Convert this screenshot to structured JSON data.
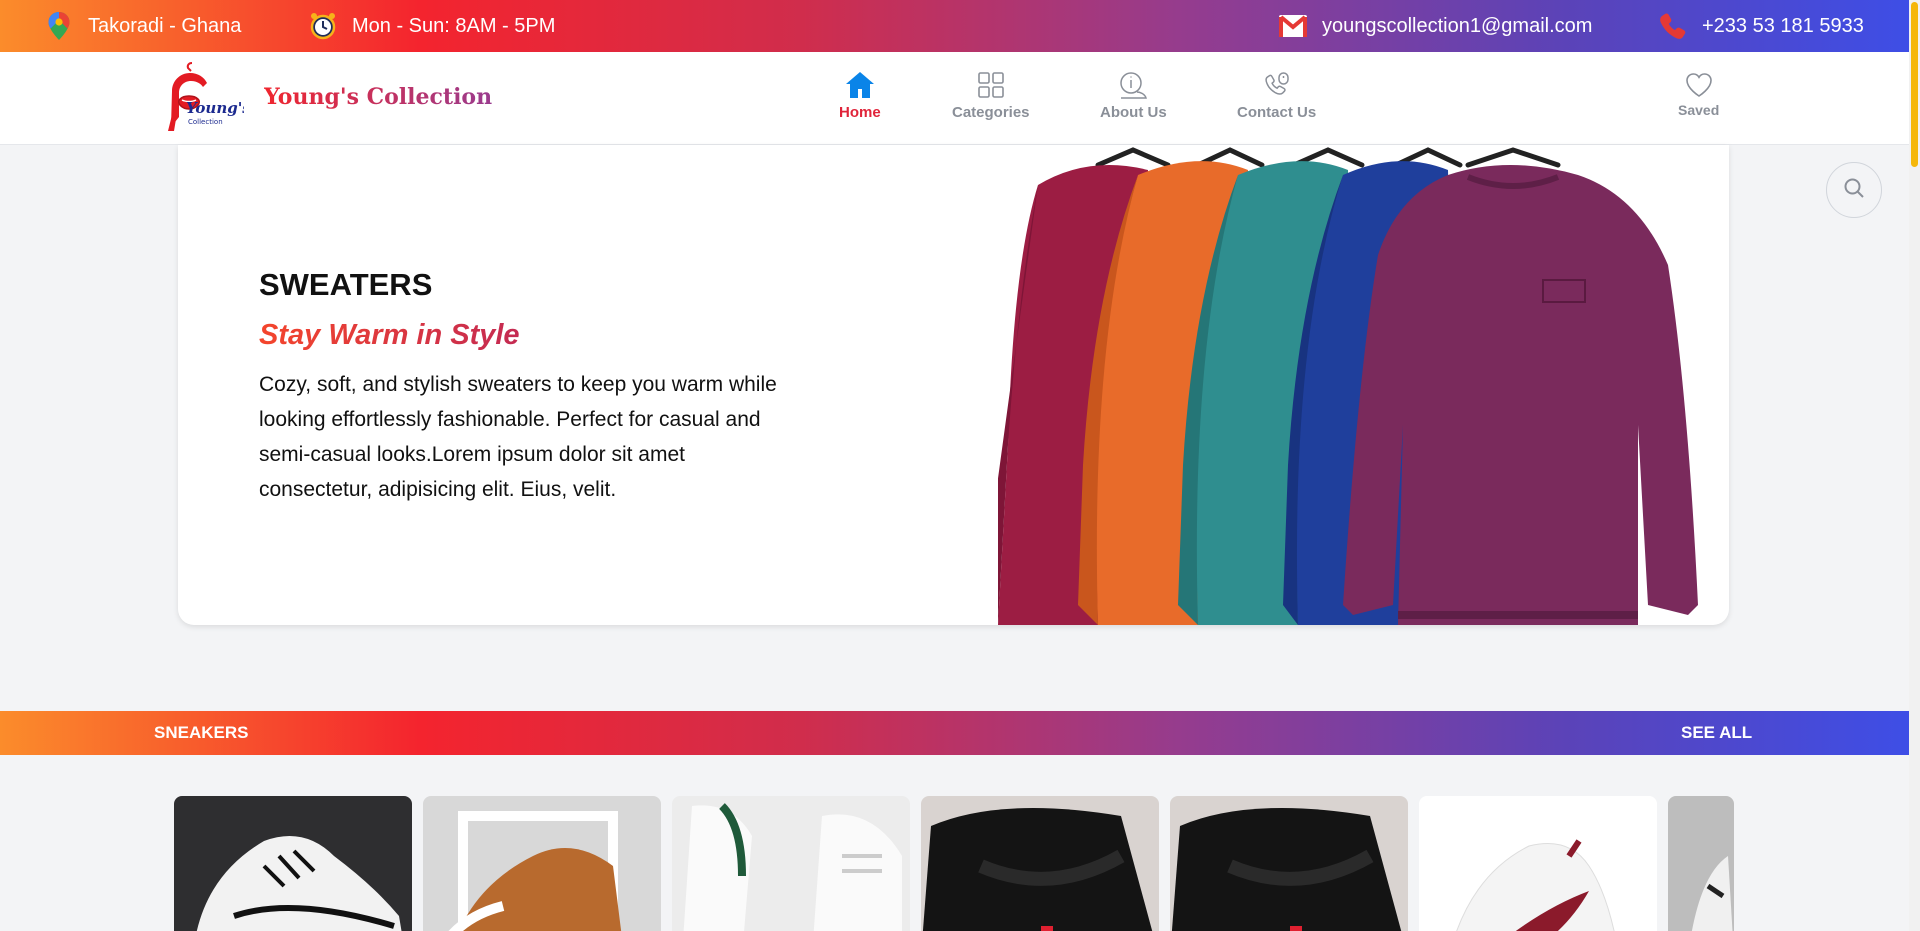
{
  "topbar": {
    "location": "Takoradi - Ghana",
    "hours": "Mon - Sun: 8AM - 5PM",
    "email": "youngscollection1@gmail.com",
    "phone": "+233 53 181 5933",
    "icons": [
      "map-pin-icon",
      "alarm-clock-icon",
      "mail-icon",
      "phone-icon"
    ]
  },
  "header": {
    "logo_text": "Young's",
    "logo_subtext": "Collection",
    "brand": "Young's Collection",
    "nav": [
      {
        "label": "Home",
        "icon": "home-icon",
        "active": true
      },
      {
        "label": "Categories",
        "icon": "grid-icon",
        "active": false
      },
      {
        "label": "About Us",
        "icon": "info-icon",
        "active": false
      },
      {
        "label": "Contact Us",
        "icon": "phone-icon",
        "active": false
      }
    ],
    "saved_label": "Saved"
  },
  "hero": {
    "title": "SWEATERS",
    "subtitle": "Stay Warm in Style",
    "description": "Cozy, soft, and stylish sweaters to keep you warm while looking effortlessly fashionable. Perfect for casual and semi-casual looks.Lorem ipsum dolor sit amet consectetur, adipisicing elit. Eius, velit.",
    "sweater_colors": [
      "#9c1d43",
      "#e86b2a",
      "#2f8e8f",
      "#1f3f9c",
      "#7a2a5c"
    ]
  },
  "section": {
    "title": "SNEAKERS",
    "see_all": "SEE ALL"
  },
  "colors": {
    "accent_red": "#e0243a",
    "active_icon": "#0a84e8",
    "gradient_start": "#fb8c2b",
    "gradient_end": "#3e4ee6"
  }
}
